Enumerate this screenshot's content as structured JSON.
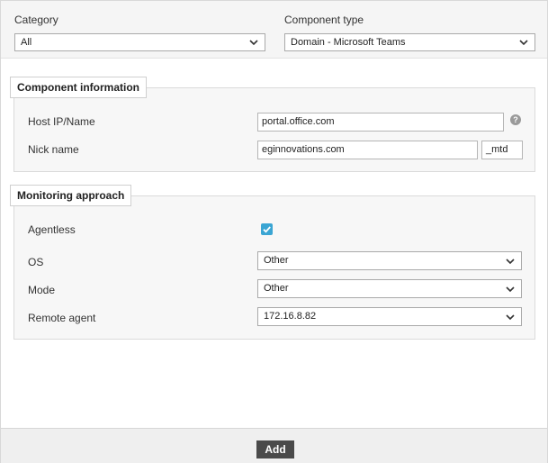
{
  "filters": {
    "category_label": "Category",
    "category_value": "All",
    "component_type_label": "Component type",
    "component_type_value": "Domain - Microsoft Teams"
  },
  "component_info": {
    "title": "Component information",
    "host_label": "Host IP/Name",
    "host_value": "portal.office.com",
    "help_glyph": "?",
    "nick_label": "Nick name",
    "nick_value": "eginnovations.com",
    "nick_suffix": "_mtd"
  },
  "monitoring": {
    "title": "Monitoring approach",
    "agentless_label": "Agentless",
    "agentless_checked": true,
    "os_label": "OS",
    "os_value": "Other",
    "mode_label": "Mode",
    "mode_value": "Other",
    "remote_agent_label": "Remote agent",
    "remote_agent_value": "172.16.8.82"
  },
  "footer": {
    "add_label": "Add"
  },
  "colors": {
    "checkbox_accent": "#3aa5d3",
    "button_bg": "#4a4a4a"
  }
}
